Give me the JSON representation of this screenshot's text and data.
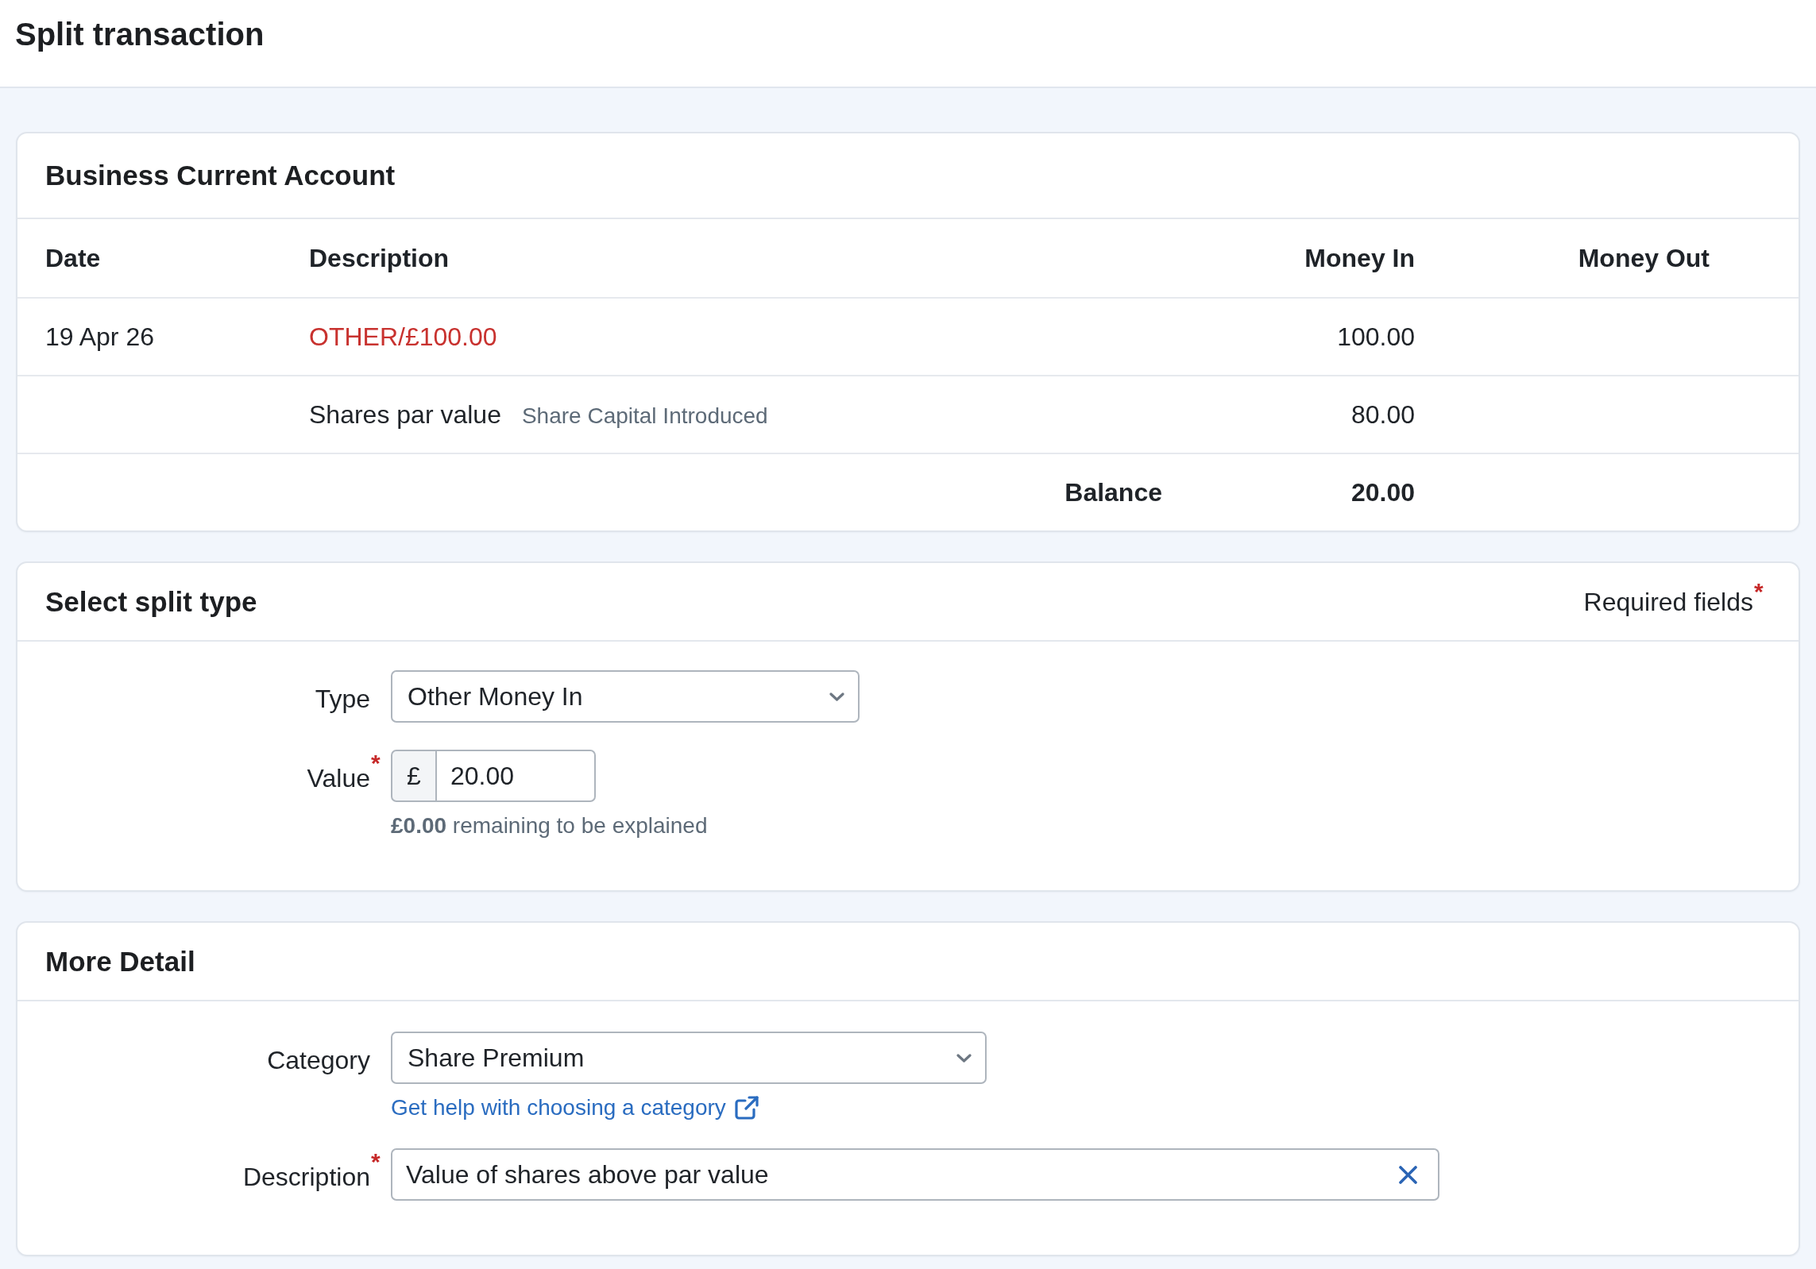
{
  "page": {
    "title": "Split transaction"
  },
  "account": {
    "title": "Business Current Account",
    "columns": [
      "Date",
      "Description",
      "Money In",
      "Money Out"
    ],
    "rows": [
      {
        "kind": "transaction",
        "date": "19 Apr 26",
        "description": "OTHER/£100.00",
        "money_in": "100.00"
      },
      {
        "kind": "split",
        "description": "Shares par value",
        "category": "Share Capital Introduced",
        "money_in": "80.00"
      },
      {
        "kind": "balance",
        "label": "Balance",
        "money_in": "20.00"
      }
    ]
  },
  "form_sections": [
    {
      "title": "Select split type",
      "required_note": {
        "text": "Required fields",
        "mark": "*"
      },
      "fields": [
        {
          "kind": "select",
          "label": "Type",
          "value": "Other Money In"
        },
        {
          "kind": "currency",
          "label": "Value",
          "required_mark": "*",
          "prefix": "£",
          "value": "20.00",
          "hint": "**£0.00** remaining to be explained"
        }
      ]
    },
    {
      "title": "More Detail",
      "fields": [
        {
          "kind": "select",
          "label": "Category",
          "value": "Share Premium",
          "help_link": "Get help with choosing a category"
        },
        {
          "kind": "text",
          "label": "Description",
          "required_mark": "*",
          "value": "Value of shares above par value",
          "clearable": true
        }
      ]
    }
  ]
}
